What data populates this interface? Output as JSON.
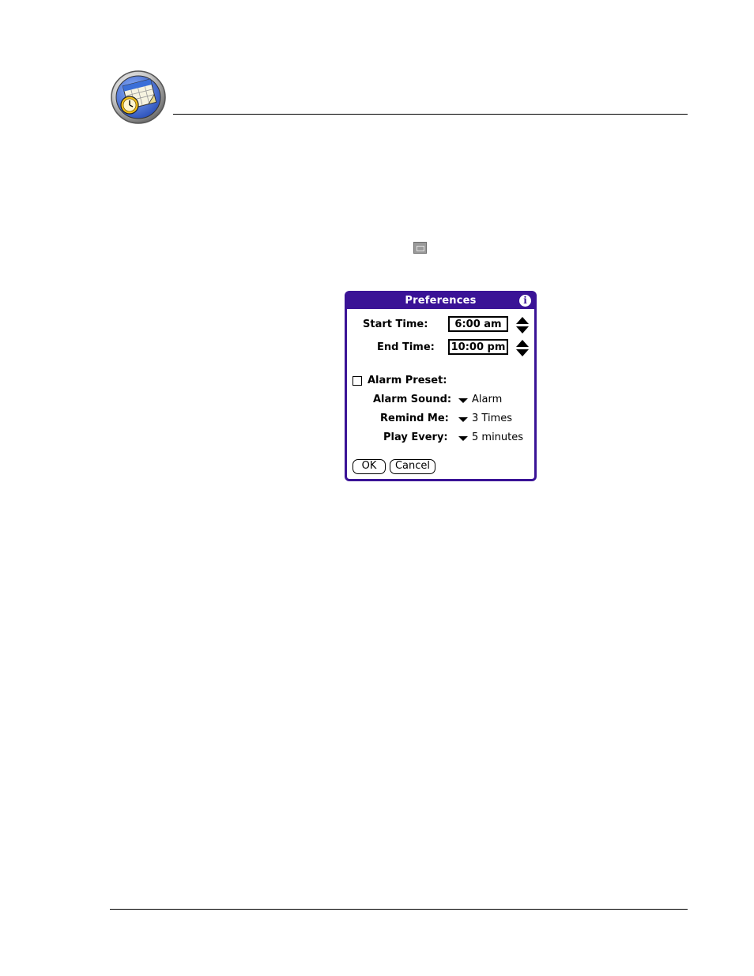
{
  "page": {
    "icon": "datebook-calendar-clock-icon",
    "menu_glyph": "menu-icon"
  },
  "dialog": {
    "title": "Preferences",
    "info_icon": "info-icon",
    "start_time_label": "Start Time:",
    "start_time_value": "6:00 am",
    "end_time_label": "End Time:",
    "end_time_value": "10:00 pm",
    "alarm_preset_label": "Alarm Preset:",
    "alarm_preset_checked": false,
    "alarm_sound_label": "Alarm Sound:",
    "alarm_sound_value": "Alarm",
    "remind_me_label": "Remind Me:",
    "remind_me_value": "3 Times",
    "play_every_label": "Play Every:",
    "play_every_value": "5 minutes",
    "ok_label": "OK",
    "cancel_label": "Cancel",
    "colors": {
      "frame": "#3a1396"
    }
  }
}
